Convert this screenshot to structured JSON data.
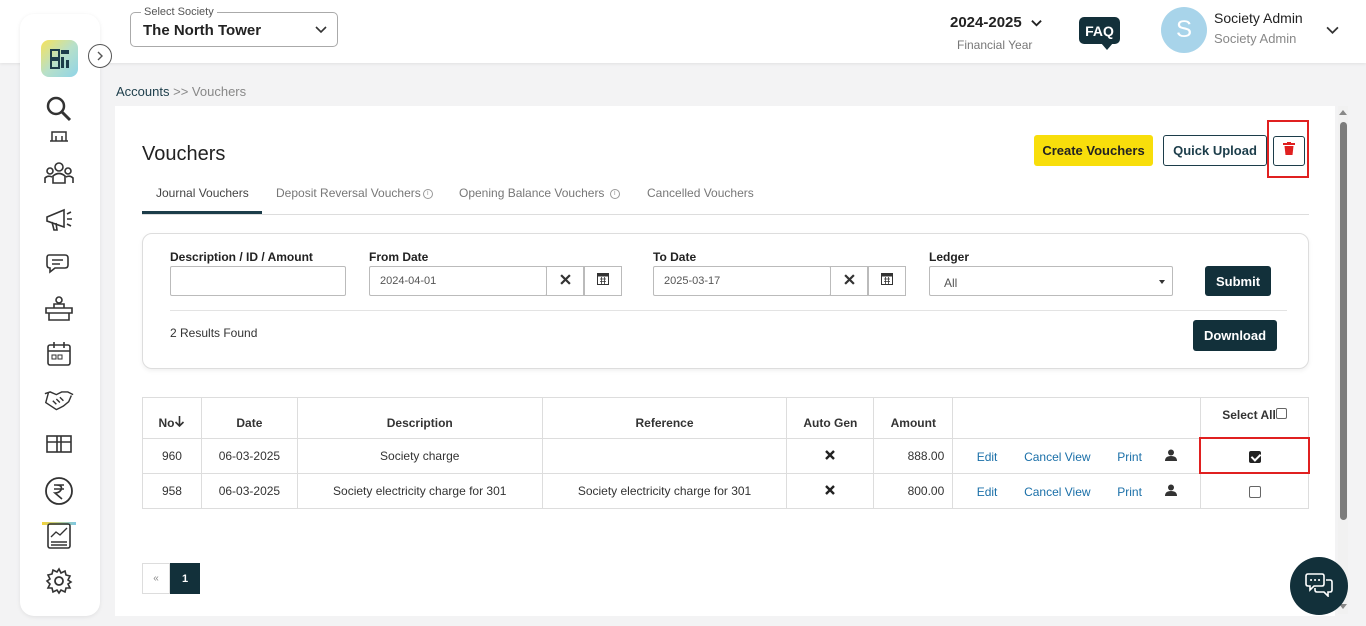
{
  "topbar": {
    "society_label": "Select Society",
    "society_value": "The North Tower",
    "financial_year": "2024-2025",
    "financial_year_label": "Financial Year",
    "faq": "FAQ",
    "avatar_letter": "S",
    "user_name": "Society Admin",
    "user_role": "Society Admin"
  },
  "breadcrumb": {
    "parent": "Accounts",
    "separator": ">>",
    "current": "Vouchers"
  },
  "page": {
    "title": "Vouchers",
    "create_button": "Create Vouchers",
    "upload_button": "Quick Upload"
  },
  "tabs": [
    "Journal Vouchers",
    "Deposit Reversal Vouchers",
    "Opening Balance Vouchers",
    "Cancelled Vouchers"
  ],
  "filters": {
    "description_label": "Description / ID / Amount",
    "description_value": "",
    "from_label": "From Date",
    "from_value": "2024-04-01",
    "to_label": "To Date",
    "to_value": "2025-03-17",
    "ledger_label": "Ledger",
    "ledger_value": "All",
    "submit": "Submit",
    "results": "2 Results Found",
    "download": "Download"
  },
  "table": {
    "headers": [
      "No",
      "Date",
      "Description",
      "Reference",
      "Auto Gen",
      "Amount",
      "",
      "Select All"
    ],
    "actions": [
      "Edit",
      "Cancel",
      "View",
      "Print"
    ],
    "rows": [
      {
        "no": "960",
        "date": "06-03-2025",
        "description": "Society charge",
        "reference": "",
        "amount": "888.00",
        "selected": true
      },
      {
        "no": "958",
        "date": "06-03-2025",
        "description": "Society electricity charge for 301",
        "reference": "Society electricity charge for 301",
        "amount": "800.00",
        "selected": false
      }
    ]
  },
  "pagination": {
    "prev": "«",
    "current": "1"
  },
  "colors": {
    "primary": "#12303a",
    "accent": "#f8de0b",
    "highlight": "#e02020",
    "link": "#1a6fa8"
  }
}
